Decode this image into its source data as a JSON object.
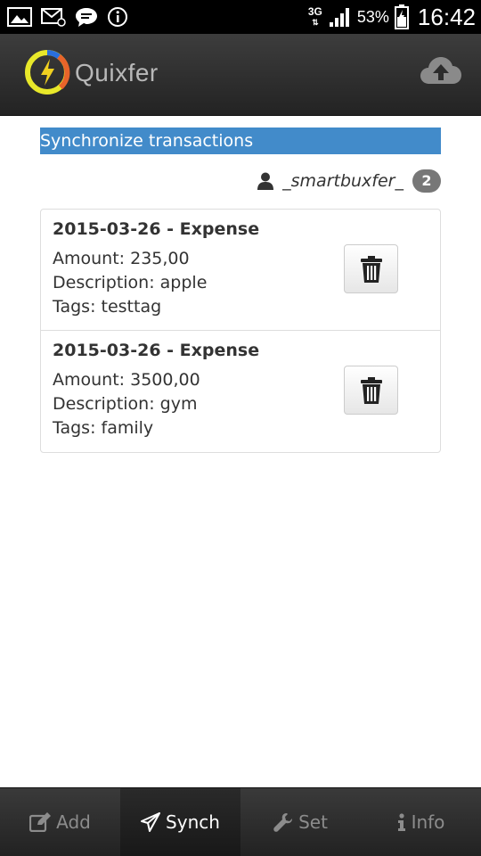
{
  "status_bar": {
    "network": "3G",
    "battery_percent": "53%",
    "time": "16:42",
    "icons": [
      "image-icon",
      "mail-icon",
      "chat-icon",
      "info-icon",
      "signal-icon",
      "battery-icon"
    ]
  },
  "header": {
    "app_name": "Quixfer",
    "cloud_icon": "cloud-upload-icon"
  },
  "section": {
    "title": "Synchronize transactions"
  },
  "user": {
    "name": "_smartbuxfer_",
    "count": "2"
  },
  "transactions": [
    {
      "heading": "2015-03-26 - Expense",
      "amount": "Amount: 235,00",
      "description": "Description: apple",
      "tags": "Tags: testtag"
    },
    {
      "heading": "2015-03-26 - Expense",
      "amount": "Amount: 3500,00",
      "description": "Description: gym",
      "tags": "Tags: family"
    }
  ],
  "nav": {
    "add": "Add",
    "synch": "Synch",
    "set": "Set",
    "info": "Info",
    "active": "synch"
  },
  "colors": {
    "accent": "#428bca",
    "badge": "#777777",
    "header_bg": "#2f2f2f"
  }
}
